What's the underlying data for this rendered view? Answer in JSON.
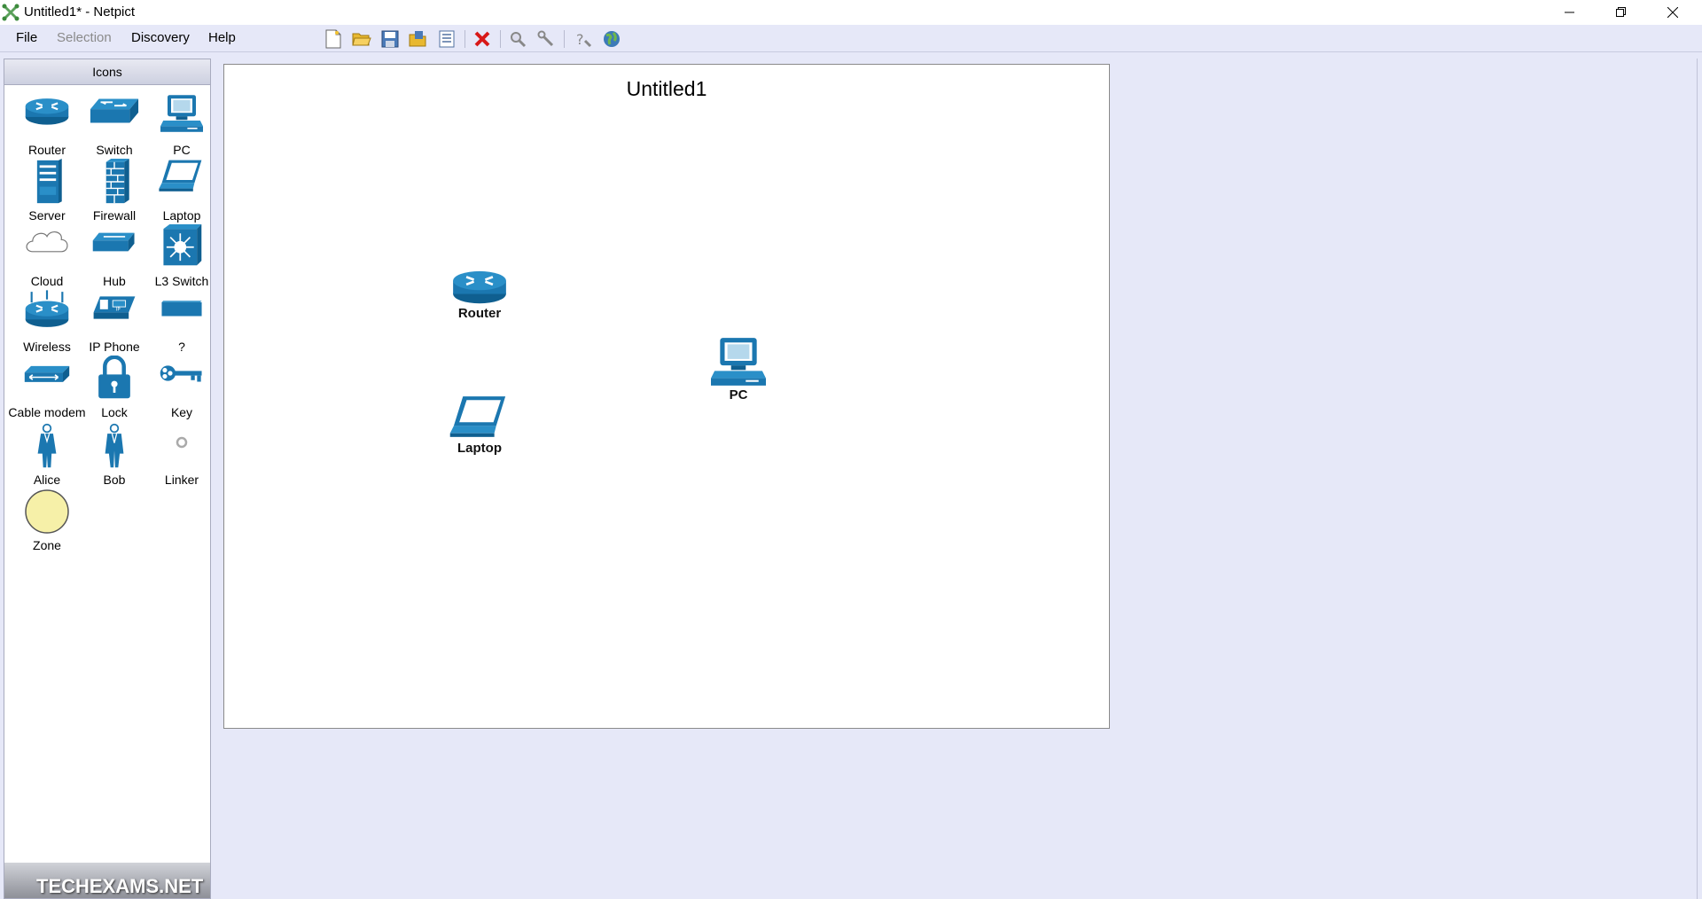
{
  "window": {
    "title": "Untitled1* - Netpict"
  },
  "menu": {
    "file": "File",
    "selection": "Selection",
    "discovery": "Discovery",
    "help": "Help"
  },
  "panel": {
    "header": "Icons",
    "items": [
      {
        "label": "Router",
        "icon": "router-icon"
      },
      {
        "label": "Switch",
        "icon": "switch-icon"
      },
      {
        "label": "PC",
        "icon": "pc-icon"
      },
      {
        "label": "Server",
        "icon": "server-icon"
      },
      {
        "label": "Firewall",
        "icon": "firewall-icon"
      },
      {
        "label": "Laptop",
        "icon": "laptop-icon"
      },
      {
        "label": "Cloud",
        "icon": "cloud-icon"
      },
      {
        "label": "Hub",
        "icon": "hub-icon"
      },
      {
        "label": "L3 Switch",
        "icon": "l3-switch-icon"
      },
      {
        "label": "Wireless",
        "icon": "wireless-router-icon"
      },
      {
        "label": "IP Phone",
        "icon": "ip-phone-icon"
      },
      {
        "label": "?",
        "icon": "generic-device-icon"
      },
      {
        "label": "Cable modem",
        "icon": "cable-modem-icon"
      },
      {
        "label": "Lock",
        "icon": "lock-icon"
      },
      {
        "label": "Key",
        "icon": "key-icon"
      },
      {
        "label": "Alice",
        "icon": "woman-icon"
      },
      {
        "label": "Bob",
        "icon": "man-icon"
      },
      {
        "label": "Linker",
        "icon": "linker-icon"
      },
      {
        "label": "Zone",
        "icon": "zone-icon"
      }
    ],
    "logo_text": "TECHEXAMS.NET"
  },
  "document": {
    "title": "Untitled1",
    "nodes": [
      {
        "label": "Router",
        "icon": "router-icon"
      },
      {
        "label": "PC",
        "icon": "pc-icon"
      },
      {
        "label": "Laptop",
        "icon": "laptop-icon"
      }
    ]
  },
  "colors": {
    "icon_blue": "#1b77b0",
    "background": "#e6e8f8",
    "zone_fill": "#f6f0a8"
  }
}
